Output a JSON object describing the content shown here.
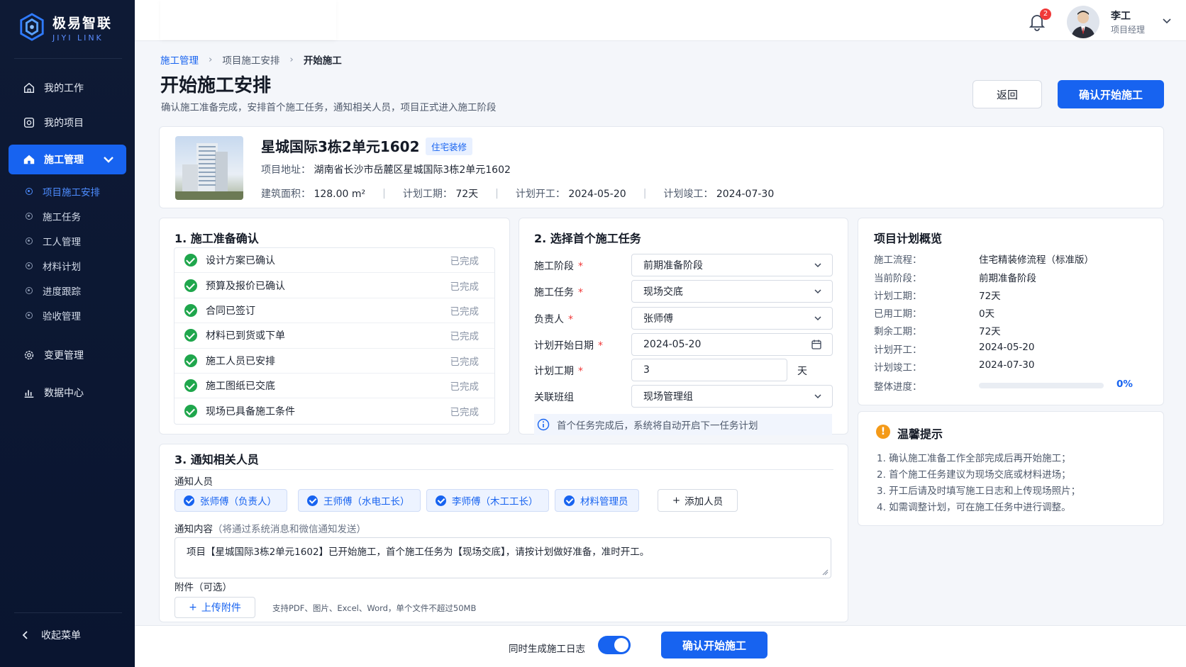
{
  "brand": {
    "name_cn": "极易智联",
    "name_en": "JIYI LINK",
    "color": "#1763f0"
  },
  "sidebar": {
    "items": [
      {
        "label": "我的工作",
        "icon": "home-icon"
      },
      {
        "label": "我的项目",
        "icon": "project-icon"
      },
      {
        "label": "施工管理",
        "icon": "construction-icon",
        "active": true
      },
      {
        "label": "变更管理",
        "icon": "gear-icon"
      },
      {
        "label": "数据中心",
        "icon": "chart-icon"
      }
    ],
    "sub_items": [
      "项目施工安排",
      "施工任务",
      "工人管理",
      "材料计划",
      "进度跟踪",
      "验收管理"
    ],
    "collapse_label": "收起菜单"
  },
  "topbar": {
    "notifications": "2",
    "user_name": "李工",
    "user_role": "项目经理"
  },
  "breadcrumb": [
    "施工管理",
    "项目施工安排",
    "开始施工"
  ],
  "page": {
    "title": "开始施工安排",
    "subtitle": "确认施工准备完成，安排首个施工任务，通知相关人员，项目正式进入施工阶段",
    "back_label": "返回",
    "confirm_label": "确认开始施工"
  },
  "project": {
    "name": "星城国际3栋2单元1602",
    "tag": "住宅装修",
    "address_label": "项目地址：",
    "address": "湖南省长沙市岳麓区星城国际3栋2单元1602",
    "area_label": "建筑面积：",
    "area": "128.00 m²",
    "duration_label": "计划工期：",
    "duration": "72天",
    "start_label": "计划开工：",
    "start": "2024-05-20",
    "end_label": "计划竣工：",
    "end": "2024-07-30"
  },
  "prep": {
    "title": "1. 施工准备确认",
    "items": [
      {
        "label": "设计方案已确认",
        "status": "已完成"
      },
      {
        "label": "预算及报价已确认",
        "status": "已完成"
      },
      {
        "label": "合同已签订",
        "status": "已完成"
      },
      {
        "label": "材料已到货或下单",
        "status": "已完成"
      },
      {
        "label": "施工人员已安排",
        "status": "已完成"
      },
      {
        "label": "施工图纸已交底",
        "status": "已完成"
      },
      {
        "label": "现场已具备施工条件",
        "status": "已完成"
      }
    ]
  },
  "task": {
    "title": "2. 选择首个施工任务",
    "stage_label": "施工阶段",
    "stage_value": "前期准备阶段",
    "task_label": "施工任务",
    "task_value": "现场交底",
    "owner_label": "负责人",
    "owner_value": "张师傅",
    "start_label": "计划开始日期",
    "start_value": "2024-05-20",
    "duration_label": "计划工期",
    "duration_value": "3",
    "duration_unit": "天",
    "team_label": "关联班组",
    "team_value": "现场管理组",
    "required_mark": "*",
    "tip": "首个任务完成后，系统将自动开启下一任务计划"
  },
  "overview": {
    "title": "项目计划概览",
    "rows": [
      {
        "label": "施工流程：",
        "value": "住宅精装修流程（标准版）"
      },
      {
        "label": "当前阶段：",
        "value": "前期准备阶段"
      },
      {
        "label": "计划工期：",
        "value": "72天"
      },
      {
        "label": "已用工期：",
        "value": "0天"
      },
      {
        "label": "剩余工期：",
        "value": "72天"
      },
      {
        "label": "计划开工：",
        "value": "2024-05-20"
      },
      {
        "label": "计划竣工：",
        "value": "2024-07-30"
      }
    ],
    "progress_label": "整体进度：",
    "progress_text": "0%",
    "progress_value": 0
  },
  "tips": {
    "title": "温馨提示",
    "items": [
      "1.  确认施工准备工作全部完成后再开始施工；",
      "2.  首个施工任务建议为现场交底或材料进场；",
      "3.  开工后请及时填写施工日志和上传现场照片；",
      "4.  如需调整计划，可在施工任务中进行调整。"
    ]
  },
  "notify": {
    "title": "3. 通知相关人员",
    "people_label": "通知人员",
    "people": [
      "张师傅（负责人）",
      "王师傅（水电工长）",
      "李师傅（木工工长）",
      "材料管理员"
    ],
    "add_label": "添加人员",
    "content_label": "通知内容",
    "content_hint": "（将通过系统消息和微信通知发送）",
    "content": "项目【星城国际3栋2单元1602】已开始施工，首个施工任务为【现场交底】，请按计划做好准备，准时开工。",
    "attach_label": "附件（可选）",
    "upload_label": "上传附件",
    "upload_hint": "支持PDF、图片、Excel、Word，单个文件不超过50MB"
  },
  "bottom": {
    "log_label": "同时生成施工日志",
    "log_enabled": true,
    "confirm_label": "确认开始施工"
  }
}
